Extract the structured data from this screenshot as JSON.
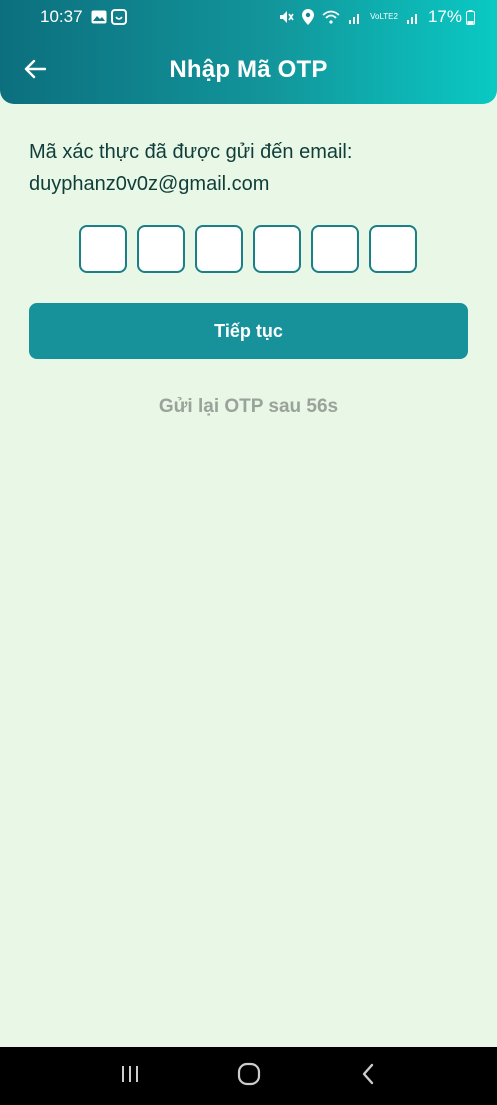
{
  "status_bar": {
    "time": "10:37",
    "battery": "17%",
    "network_label": "VoLTE2"
  },
  "header": {
    "title": "Nhập Mã OTP"
  },
  "message": {
    "line1": "Mã xác thực đã được gửi đến email:",
    "email": "duyphanz0v0z@gmail.com"
  },
  "otp": {
    "digits": [
      "",
      "",
      "",
      "",
      "",
      ""
    ]
  },
  "continue_label": "Tiếp tục",
  "resend_text": "Gửi lại OTP sau 56s",
  "colors": {
    "header_start": "#0c6f7e",
    "header_end": "#0ac9c4",
    "background": "#e9f7e6",
    "accent": "#17919a",
    "text_dark": "#0f3d3a",
    "text_muted": "#9aa39a"
  },
  "icons": {
    "back": "arrow-left-icon",
    "recent": "recent-apps-icon",
    "home": "home-icon",
    "nav_back": "chevron-left-icon"
  }
}
